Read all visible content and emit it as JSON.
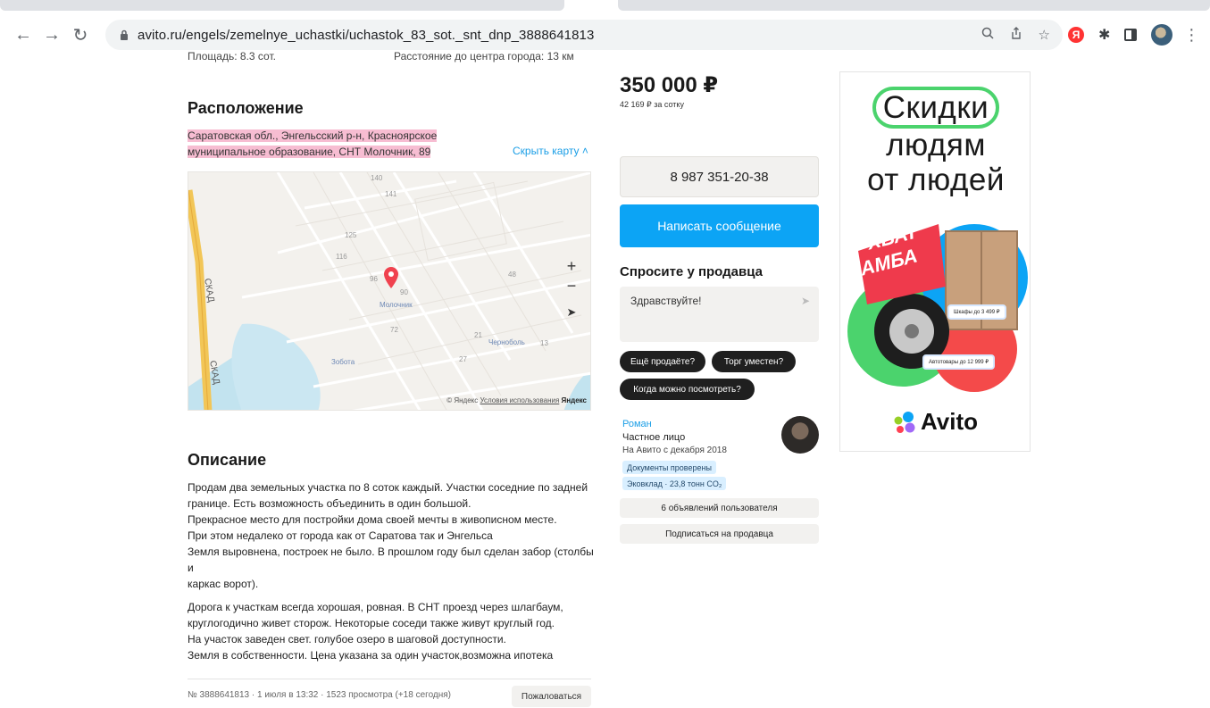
{
  "browser": {
    "url": "avito.ru/engels/zemelnye_uchastki/uchastok_83_sot._snt_dnp_3888641813",
    "ext_ya": "Я"
  },
  "listing": {
    "cut_left": "Площадь: 8.3 сот.",
    "cut_right": "Расстояние до центра города: 13 км",
    "location_title": "Расположение",
    "address_line1": "Саратовская обл., Энгельсский р-н, Красноярское",
    "address_line2": "муниципальное образование, СНТ Молочник, 89",
    "hide_map": "Скрыть карту ˄",
    "map": {
      "road1": "СКАД",
      "road2": "СКАД",
      "place1": "Молочник",
      "place2": "Зобота",
      "place3": "Черноболь",
      "plot_numbers": [
        "140",
        "141",
        "125",
        "116",
        "96",
        "90",
        "72",
        "27",
        "13",
        "21",
        "48"
      ],
      "zoom_in": "+",
      "zoom_out": "−",
      "copyright": "© Яндекс",
      "terms": "Условия использования",
      "yandex": "Яндекс"
    },
    "description_title": "Описание",
    "description_p1": [
      "Продам два земельных участка по 8 соток каждый. Участки соседние по задней",
      "границе. Есть возможность объединить в один большой.",
      "Прекрасное место для постройки дома своей мечты в живописном месте.",
      "При этом недалеко от города как от Саратова так и Энгельса",
      "Земля выровнена, построек не было. В прошлом году был сделан забор (столбы и",
      "каркас ворот)."
    ],
    "description_p2": [
      "Дорога к участкам всегда хорошая, ровная. В СНТ проезд через шлагбаум,",
      "круглогодично живет сторож. Некоторые соседи также живут круглый год.",
      "На участок заведен свет. голубое озеро в шаговой доступности.",
      "Земля в собственности. Цена указана за один участок,возможна ипотека"
    ],
    "meta": "№ 3888641813 · 1 июля в 13:32 · 1523 просмотра (+18 сегодня)",
    "report": "Пожаловаться"
  },
  "seller": {
    "price": "350 000 ₽",
    "per_sotka": "42 169 ₽ за сотку",
    "phone": "8 987 351-20-38",
    "message_btn": "Написать сообщение",
    "ask_title": "Спросите у продавца",
    "ask_placeholder": "Здравствуйте!",
    "chips": [
      "Ещё продаёте?",
      "Торг уместен?",
      "Когда можно посмотреть?"
    ],
    "name": "Роман",
    "type": "Частное лицо",
    "since": "На Авито с декабря 2018",
    "badge1": "Документы проверены",
    "badge2": "Эковклад · 23,8 тонн CO₂",
    "listings_btn": "6 объявлений пользователя",
    "subscribe_btn": "Подписаться на продавца"
  },
  "ad": {
    "line1": "Скидки",
    "line2": "людям",
    "line3": "от людей",
    "promo1": "ХВАТ",
    "promo2": "АМБА",
    "tag1": "Шкафы до 3 499 ₽",
    "tag2": "Автотовары до 12 999 ₽",
    "logo": "Avito"
  },
  "colors": {
    "accent_blue": "#0ca4f5",
    "link": "#1a9ee6",
    "highlight": "#f7bdd2",
    "chip": "#1f1f1f"
  }
}
